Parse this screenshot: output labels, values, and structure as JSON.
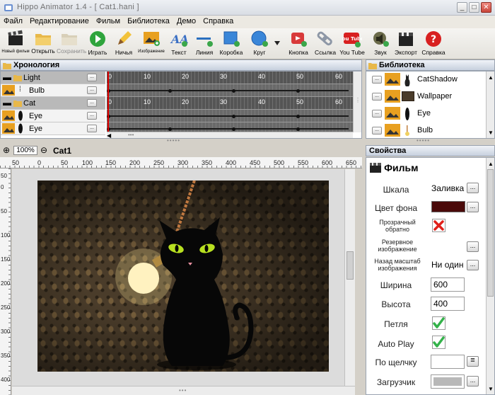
{
  "window": {
    "title": "Hippo Animator 1.4 - [ Cat1.hani ]",
    "min": "_",
    "max": "□",
    "close": "✕"
  },
  "menu": [
    "Файл",
    "Редактирование",
    "Фильм",
    "Библиотека",
    "Демо",
    "Справка"
  ],
  "toolbar": {
    "new": "Новый фильм",
    "open": "Открыть",
    "save": "Сохранить",
    "play": "Играть",
    "brush": "Ничья",
    "image": "Изображение",
    "text": "Текст",
    "line": "Линия",
    "box": "Коробка",
    "circle": "Круг",
    "button": "Кнопка",
    "link": "Ссылка",
    "youtube": "You Tube",
    "sound": "Звук",
    "export": "Экспорт",
    "help": "Справка",
    "yt_badge": "You Tube"
  },
  "timeline": {
    "title": "Хронология",
    "rows": [
      {
        "name": "Light",
        "type": "layer"
      },
      {
        "name": "Bulb",
        "type": "item"
      },
      {
        "name": "Cat",
        "type": "layer"
      },
      {
        "name": "Eye",
        "type": "item"
      },
      {
        "name": "Eye",
        "type": "item"
      }
    ],
    "tick_labels": [
      "0",
      "10",
      "20",
      "30",
      "40",
      "50",
      "60"
    ],
    "button_label": "..."
  },
  "library": {
    "title": "Библиотека",
    "items": [
      "CatShadow",
      "Wallpaper",
      "Eye",
      "Bulb"
    ]
  },
  "stage": {
    "zoom": "100%",
    "scene_name": "Cat1",
    "ruler_h": [
      "50",
      "0",
      "50",
      "100",
      "150",
      "200",
      "250",
      "300",
      "350",
      "400",
      "450",
      "500",
      "550",
      "600",
      "650"
    ],
    "ruler_v": [
      "50",
      "0",
      "50",
      "100",
      "150",
      "200",
      "250",
      "300",
      "350",
      "400"
    ]
  },
  "properties": {
    "title": "Свойства",
    "section": "Фильм",
    "scale_label": "Шкала",
    "scale_value": "Заливка",
    "bg_label": "Цвет фона",
    "bg_color": "#4a0a0a",
    "transparent_label": "Прозрачный обратно",
    "fallback_label": "Резервное изображение",
    "backscale_label": "Назад масштаб изображения",
    "backscale_value": "Ни один",
    "width_label": "Ширина",
    "width_value": "600",
    "height_label": "Высота",
    "height_value": "400",
    "loop_label": "Петля",
    "autoplay_label": "Auto Play",
    "onclick_label": "По щелчку",
    "onclick_value": "",
    "loader_label": "Загрузчик",
    "more_btn": "..."
  },
  "colors": {
    "accent": "#2a6fbf",
    "check": "#34b24a",
    "cross": "#e0201a"
  }
}
